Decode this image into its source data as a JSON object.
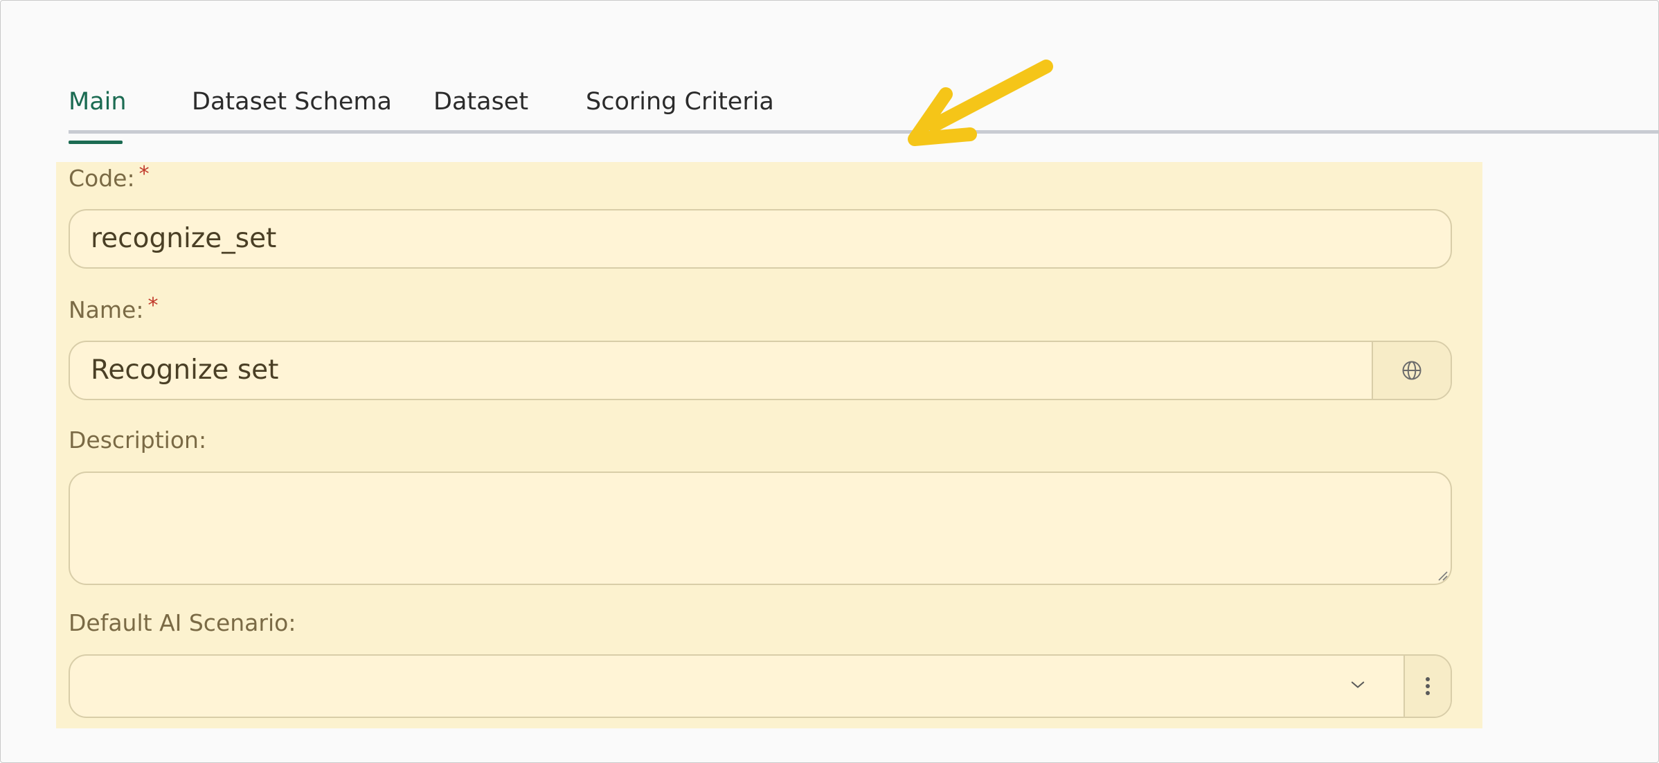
{
  "tabs": [
    {
      "label": "Main",
      "active": true
    },
    {
      "label": "Dataset Schema",
      "active": false
    },
    {
      "label": "Dataset",
      "active": false
    },
    {
      "label": "Scoring Criteria",
      "active": false
    }
  ],
  "form": {
    "code": {
      "label": "Code:",
      "required_mark": "*",
      "value": "recognize_set"
    },
    "name": {
      "label": "Name:",
      "required_mark": "*",
      "value": "Recognize set",
      "addon_icon": "globe-icon"
    },
    "description": {
      "label": "Description:",
      "value": ""
    },
    "default_ai_scenario": {
      "label": "Default AI Scenario:",
      "value": "",
      "dropdown_icon": "chevron-down-icon",
      "menu_icon": "more-vertical-icon"
    }
  },
  "annotation": {
    "icon": "arrow-annotation-icon",
    "color": "#f5c518"
  },
  "colors": {
    "accent": "#1b6b52",
    "panel_highlight": "#fcf2cf"
  }
}
